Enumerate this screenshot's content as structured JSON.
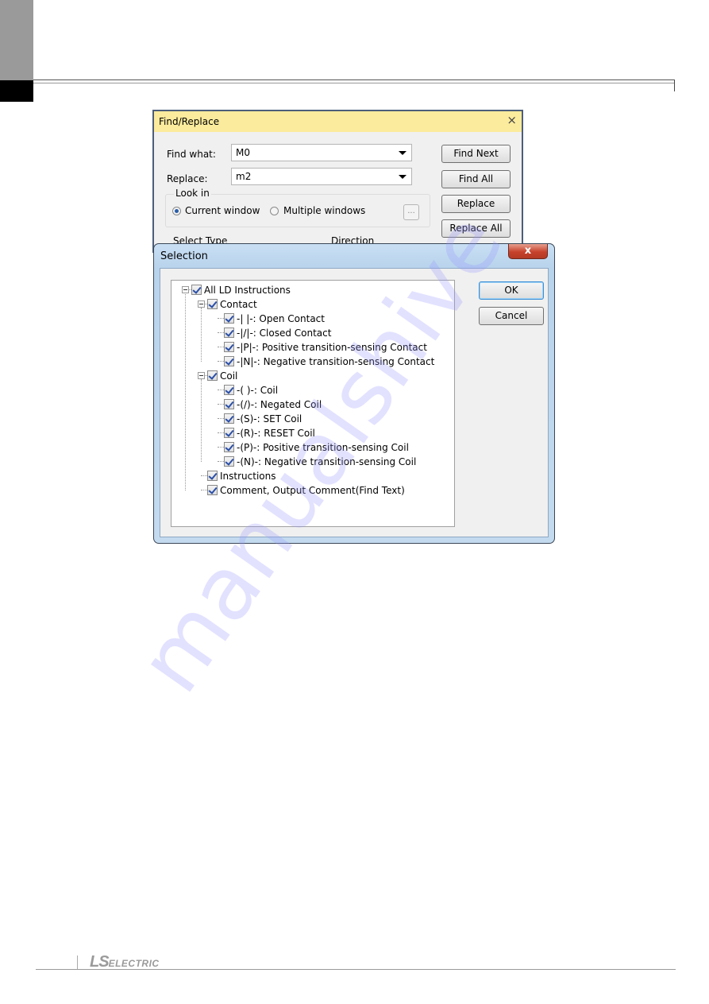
{
  "page": {
    "footer_brand": {
      "ls": "LS",
      "electric": "ELECTRIC"
    },
    "watermark": "manualshive"
  },
  "find_replace": {
    "title": "Find/Replace",
    "close_icon": "×",
    "find_what_label": "Find what:",
    "find_what_value": "M0",
    "replace_label": "Replace:",
    "replace_value": "m2",
    "look_in": {
      "title": "Look in",
      "options": [
        {
          "label": "Current window",
          "selected": true
        },
        {
          "label": "Multiple windows",
          "selected": false
        }
      ],
      "browse_label": "..."
    },
    "buttons": {
      "find_next": "Find Next",
      "find_all": "Find All",
      "replace": "Replace",
      "replace_all": "Replace All"
    },
    "select_type_label": "Select Type",
    "direction_label": "Direction"
  },
  "selection": {
    "title": "Selection",
    "close_icon": "x",
    "ok_label": "OK",
    "cancel_label": "Cancel",
    "tree": [
      {
        "label": "All LD Instructions",
        "checked": true,
        "level": 0,
        "expanded": true
      },
      {
        "label": "Contact",
        "checked": true,
        "level": 1,
        "expanded": true
      },
      {
        "label": "-| |-: Open Contact",
        "checked": true,
        "level": 2
      },
      {
        "label": "-|/|-: Closed Contact",
        "checked": true,
        "level": 2
      },
      {
        "label": "-|P|-: Positive transition-sensing Contact",
        "checked": true,
        "level": 2
      },
      {
        "label": "-|N|-: Negative transition-sensing Contact",
        "checked": true,
        "level": 2
      },
      {
        "label": "Coil",
        "checked": true,
        "level": 1,
        "expanded": true
      },
      {
        "label": "-( )-: Coil",
        "checked": true,
        "level": 2
      },
      {
        "label": "-(/)-: Negated Coil",
        "checked": true,
        "level": 2
      },
      {
        "label": "-(S)-: SET Coil",
        "checked": true,
        "level": 2
      },
      {
        "label": "-(R)-: RESET Coil",
        "checked": true,
        "level": 2
      },
      {
        "label": "-(P)-: Positive transition-sensing Coil",
        "checked": true,
        "level": 2
      },
      {
        "label": "-(N)-: Negative transition-sensing Coil",
        "checked": true,
        "level": 2
      },
      {
        "label": "Instructions",
        "checked": true,
        "level": 1
      },
      {
        "label": "Comment, Output Comment(Find Text)",
        "checked": true,
        "level": 1
      }
    ]
  }
}
